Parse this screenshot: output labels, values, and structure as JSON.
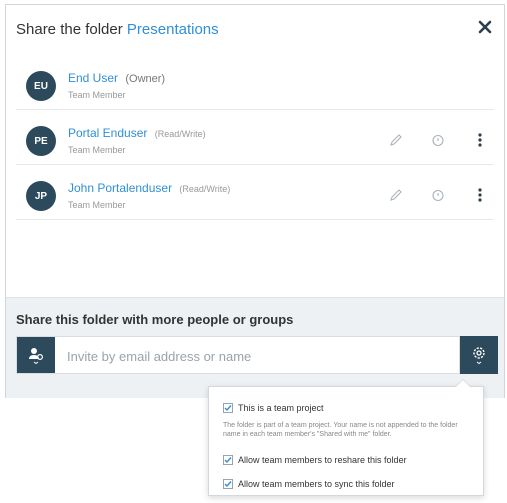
{
  "dialog": {
    "title_prefix": "Share the folder",
    "folder_name": "Presentations",
    "close_icon": "close-icon"
  },
  "members": [
    {
      "initials": "EU",
      "name": "End User",
      "permission": "(Owner)",
      "role": "Team Member",
      "is_owner": true
    },
    {
      "initials": "PE",
      "name": "Portal Enduser",
      "permission": "(Read/Write)",
      "role": "Team Member",
      "is_owner": false
    },
    {
      "initials": "JP",
      "name": "John Portalenduser",
      "permission": "(Read/Write)",
      "role": "Team Member",
      "is_owner": false
    }
  ],
  "share": {
    "title": "Share this folder with more people or groups",
    "input_placeholder": "Invite by email address or name",
    "input_value": "",
    "invite_icon": "add-person-icon",
    "settings_icon": "gear-icon"
  },
  "popover": {
    "team_project_label": "This is a team project",
    "team_project_checked": true,
    "team_project_desc": "The folder is part of a team project. Your name is not appended to the folder name in each team member's \"Shared with me\" folder.",
    "reshare_label": "Allow team members to reshare this folder",
    "reshare_checked": true,
    "sync_label": "Allow team members to sync this folder",
    "sync_checked": true
  },
  "colors": {
    "accent": "#2f8fd8",
    "dark": "#2c4a5c"
  }
}
